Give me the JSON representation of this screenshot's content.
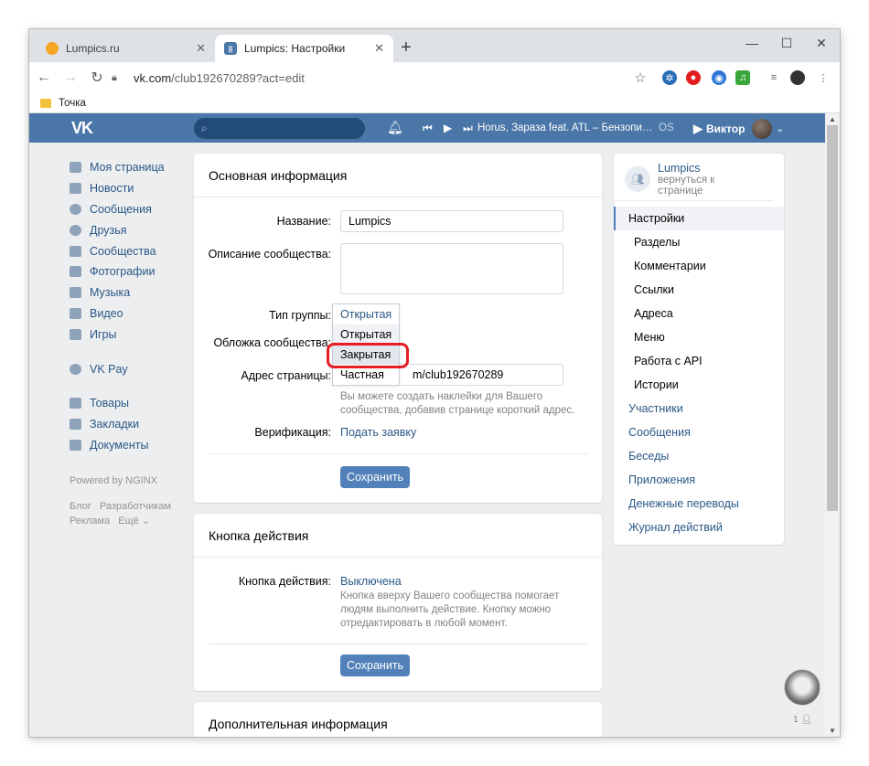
{
  "browser": {
    "tabs": [
      {
        "label": "Lumpics.ru",
        "favicon": "orange-circle-icon"
      },
      {
        "label": "Lumpics: Настройки",
        "favicon": "vk-blue-icon"
      }
    ],
    "new_tab": "+",
    "address": {
      "host": "vk.com",
      "path": "/club192670289?act=edit"
    },
    "bookmark": "Точка"
  },
  "vk": {
    "logo": "VK",
    "now_playing": "Horus, Зараза feat. ATL – Бензопи…",
    "os_label": "OS",
    "user_name": "Виктор"
  },
  "left_menu": {
    "items": [
      "Моя страница",
      "Новости",
      "Сообщения",
      "Друзья",
      "Сообщества",
      "Фотографии",
      "Музыка",
      "Видео",
      "Игры"
    ],
    "vkpay": "VK Pay",
    "items2": [
      "Товары",
      "Закладки",
      "Документы"
    ],
    "powered": "Powered by NGINX",
    "footer1a": "Блог",
    "footer1b": "Разработчикам",
    "footer2a": "Реклама",
    "footer2b": "Ещё ⌄"
  },
  "basic": {
    "title": "Основная информация",
    "name_label": "Название:",
    "name_value": "Lumpics",
    "desc_label": "Описание сообщества:",
    "desc_value": "",
    "type_label": "Тип группы:",
    "cover_label": "Обложка сообщества:",
    "address_label": "Адрес страницы:",
    "address_value_prefix": "m/club192670289",
    "address_hint": "Вы можете создать наклейки для Вашего сообщества, добавив странице короткий адрес.",
    "verify_label": "Верификация:",
    "verify_link": "Подать заявку",
    "save": "Сохранить"
  },
  "group_type_dropdown": {
    "current": "Открытая",
    "options": [
      "Открытая",
      "Закрытая",
      "Частная"
    ],
    "hovered": "Закрытая"
  },
  "action": {
    "title": "Кнопка действия",
    "label": "Кнопка действия:",
    "value": "Выключена",
    "hint": "Кнопка вверху Вашего сообщества помогает людям выполнить действие. Кнопку можно отредактировать в любой момент.",
    "save": "Сохранить"
  },
  "extra": {
    "title": "Дополнительная информация"
  },
  "right_menu": {
    "group_name": "Lumpics",
    "back_link": "вернуться к странице",
    "items": [
      {
        "label": "Настройки",
        "kind": "active"
      },
      {
        "label": "Разделы",
        "kind": "sub"
      },
      {
        "label": "Комментарии",
        "kind": "sub"
      },
      {
        "label": "Ссылки",
        "kind": "sub"
      },
      {
        "label": "Адреса",
        "kind": "sub"
      },
      {
        "label": "Меню",
        "kind": "sub"
      },
      {
        "label": "Работа с API",
        "kind": "sub"
      },
      {
        "label": "Истории",
        "kind": "sub"
      },
      {
        "label": "Участники",
        "kind": "top"
      },
      {
        "label": "Сообщения",
        "kind": "top"
      },
      {
        "label": "Беседы",
        "kind": "top"
      },
      {
        "label": "Приложения",
        "kind": "top"
      },
      {
        "label": "Денежные переводы",
        "kind": "top"
      },
      {
        "label": "Журнал действий",
        "kind": "top"
      }
    ]
  },
  "chat": {
    "count": "1"
  },
  "colors": {
    "vk_blue": "#4a76a8",
    "button": "#5181b8",
    "link": "#2a5885",
    "highlight": "#e31e24"
  }
}
